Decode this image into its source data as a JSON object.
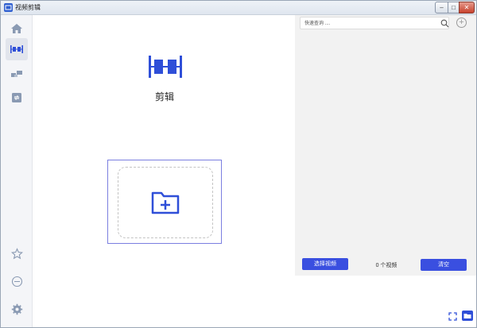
{
  "window": {
    "title": "视频剪辑",
    "min_label": "–",
    "max_label": "□",
    "close_label": "✕"
  },
  "sidebar": {
    "items": [
      {
        "icon": "home-icon"
      },
      {
        "icon": "clip-icon",
        "active": true
      },
      {
        "icon": "blocks-icon"
      },
      {
        "icon": "convert-icon"
      }
    ],
    "bottom": [
      {
        "icon": "star-icon"
      },
      {
        "icon": "globe-icon"
      },
      {
        "icon": "gear-icon"
      }
    ]
  },
  "main": {
    "mode_label": "剪辑"
  },
  "right_panel": {
    "search_placeholder": "快速查询 ....",
    "select_button": "选择视频",
    "count_text": "0 个视频",
    "clear_button": "清空"
  },
  "colors": {
    "accent": "#3a4fe0",
    "icon_blue": "#2f4fd8",
    "sidebar_icon": "#8a9ab3"
  }
}
